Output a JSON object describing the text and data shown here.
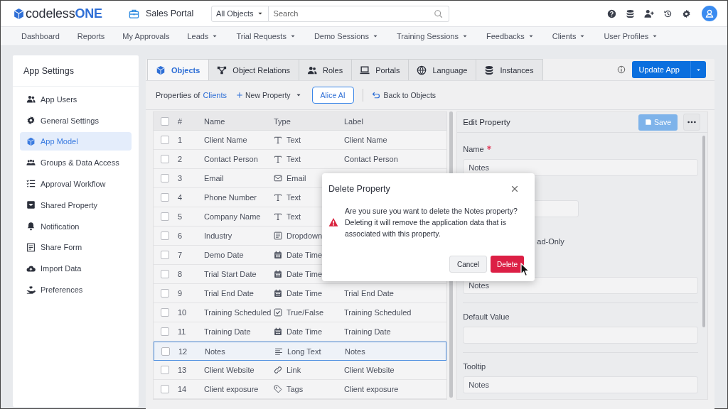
{
  "header": {
    "logo": {
      "prefix": "codeless",
      "suffix": "ONE"
    },
    "app_name": "Sales Portal",
    "object_filter": "All Objects",
    "search": {
      "placeholder": "Search"
    }
  },
  "nav": [
    {
      "label": "Dashboard",
      "has_menu": false
    },
    {
      "label": "Reports",
      "has_menu": false
    },
    {
      "label": "My Approvals",
      "has_menu": false
    },
    {
      "label": "Leads",
      "has_menu": true
    },
    {
      "label": "Trial Requests",
      "has_menu": true
    },
    {
      "label": "Demo Sessions",
      "has_menu": true
    },
    {
      "label": "Training Sessions",
      "has_menu": true
    },
    {
      "label": "Feedbacks",
      "has_menu": true
    },
    {
      "label": "Clients",
      "has_menu": true
    },
    {
      "label": "User Profiles",
      "has_menu": true
    }
  ],
  "sidebar": {
    "title": "App Settings",
    "items": [
      {
        "label": "App Users",
        "selected": false
      },
      {
        "label": "General Settings",
        "selected": false
      },
      {
        "label": "App Model",
        "selected": true
      },
      {
        "label": "Groups & Data Access",
        "selected": false
      },
      {
        "label": "Approval Workflow",
        "selected": false
      },
      {
        "label": "Shared Property",
        "selected": false
      },
      {
        "label": "Notification",
        "selected": false
      },
      {
        "label": "Share Form",
        "selected": false
      },
      {
        "label": "Import Data",
        "selected": false
      },
      {
        "label": "Preferences",
        "selected": false
      }
    ]
  },
  "tabs": [
    {
      "label": "Objects",
      "selected": true
    },
    {
      "label": "Object Relations",
      "selected": false
    },
    {
      "label": "Roles",
      "selected": false
    },
    {
      "label": "Portals",
      "selected": false
    },
    {
      "label": "Language",
      "selected": false
    },
    {
      "label": "Instances",
      "selected": false
    }
  ],
  "update_button": "Update App",
  "toolbar": {
    "prefix": "Properties of",
    "object_link": "Clients",
    "new_property": "New Property",
    "alice_ai": "Alice AI",
    "back": "Back to Objects"
  },
  "table": {
    "all_checked": false,
    "columns": [
      "#",
      "Name",
      "Type",
      "Label"
    ],
    "rows": [
      {
        "number": "1",
        "name": "Client Name",
        "type": "Text",
        "kind": "text",
        "label": "Client Name",
        "checked": false,
        "selected": false
      },
      {
        "number": "2",
        "name": "Contact Person",
        "type": "Text",
        "kind": "text",
        "label": "Contact Person",
        "checked": false,
        "selected": false
      },
      {
        "number": "3",
        "name": "Email",
        "type": "Email",
        "kind": "email",
        "checked": false,
        "selected": false
      },
      {
        "number": "4",
        "name": "Phone Number",
        "type": "Text",
        "kind": "text",
        "checked": false,
        "selected": false
      },
      {
        "number": "5",
        "name": "Company Name",
        "type": "Text",
        "kind": "text",
        "checked": false,
        "selected": false
      },
      {
        "number": "6",
        "name": "Industry",
        "type": "Dropdown",
        "kind": "dropdown",
        "checked": false,
        "selected": false
      },
      {
        "number": "7",
        "name": "Demo Date",
        "type": "Date Time",
        "kind": "datetime",
        "checked": false,
        "selected": false
      },
      {
        "number": "8",
        "name": "Trial Start Date",
        "type": "Date Time",
        "kind": "datetime",
        "checked": false,
        "selected": false
      },
      {
        "number": "9",
        "name": "Trial End Date",
        "type": "Date Time",
        "kind": "datetime",
        "label": "Trial End Date",
        "checked": false,
        "selected": false
      },
      {
        "number": "10",
        "name": "Training Scheduled",
        "type": "True/False",
        "kind": "boolean",
        "label": "Training Scheduled",
        "checked": false,
        "selected": false
      },
      {
        "number": "11",
        "name": "Training Date",
        "type": "Date Time",
        "kind": "datetime",
        "label": "Training Date",
        "checked": false,
        "selected": false
      },
      {
        "number": "12",
        "name": "Notes",
        "type": "Long Text",
        "kind": "longtext",
        "label": "Notes",
        "checked": false,
        "selected": true
      },
      {
        "number": "13",
        "name": "Client Website",
        "type": "Link",
        "kind": "link",
        "label": "Client Website",
        "checked": false,
        "selected": false
      },
      {
        "number": "14",
        "name": "Client exposure",
        "type": "Tags",
        "kind": "tags",
        "label": "Client exposure",
        "checked": false,
        "selected": false
      }
    ]
  },
  "edit_panel": {
    "title": "Edit Property",
    "save": {
      "label": "Save",
      "disabled": true
    },
    "fields": [
      {
        "kind": "text",
        "label": "Name",
        "required": true,
        "value": "Notes"
      },
      {
        "kind": "short"
      },
      {
        "kind": "checkbox",
        "label": "ad-Only"
      },
      {
        "kind": "text",
        "value": "Notes"
      },
      {
        "kind": "text",
        "label": "Default Value",
        "required": false
      },
      {
        "kind": "text",
        "label": "Tooltip",
        "required": false,
        "value": "Notes"
      }
    ]
  },
  "dialog": {
    "title": "Delete Property",
    "message": "Are you sure you want to delete the Notes property? Deleting it will remove the application data that is associated with this property.",
    "cancel": "Cancel",
    "confirm": "Delete"
  }
}
